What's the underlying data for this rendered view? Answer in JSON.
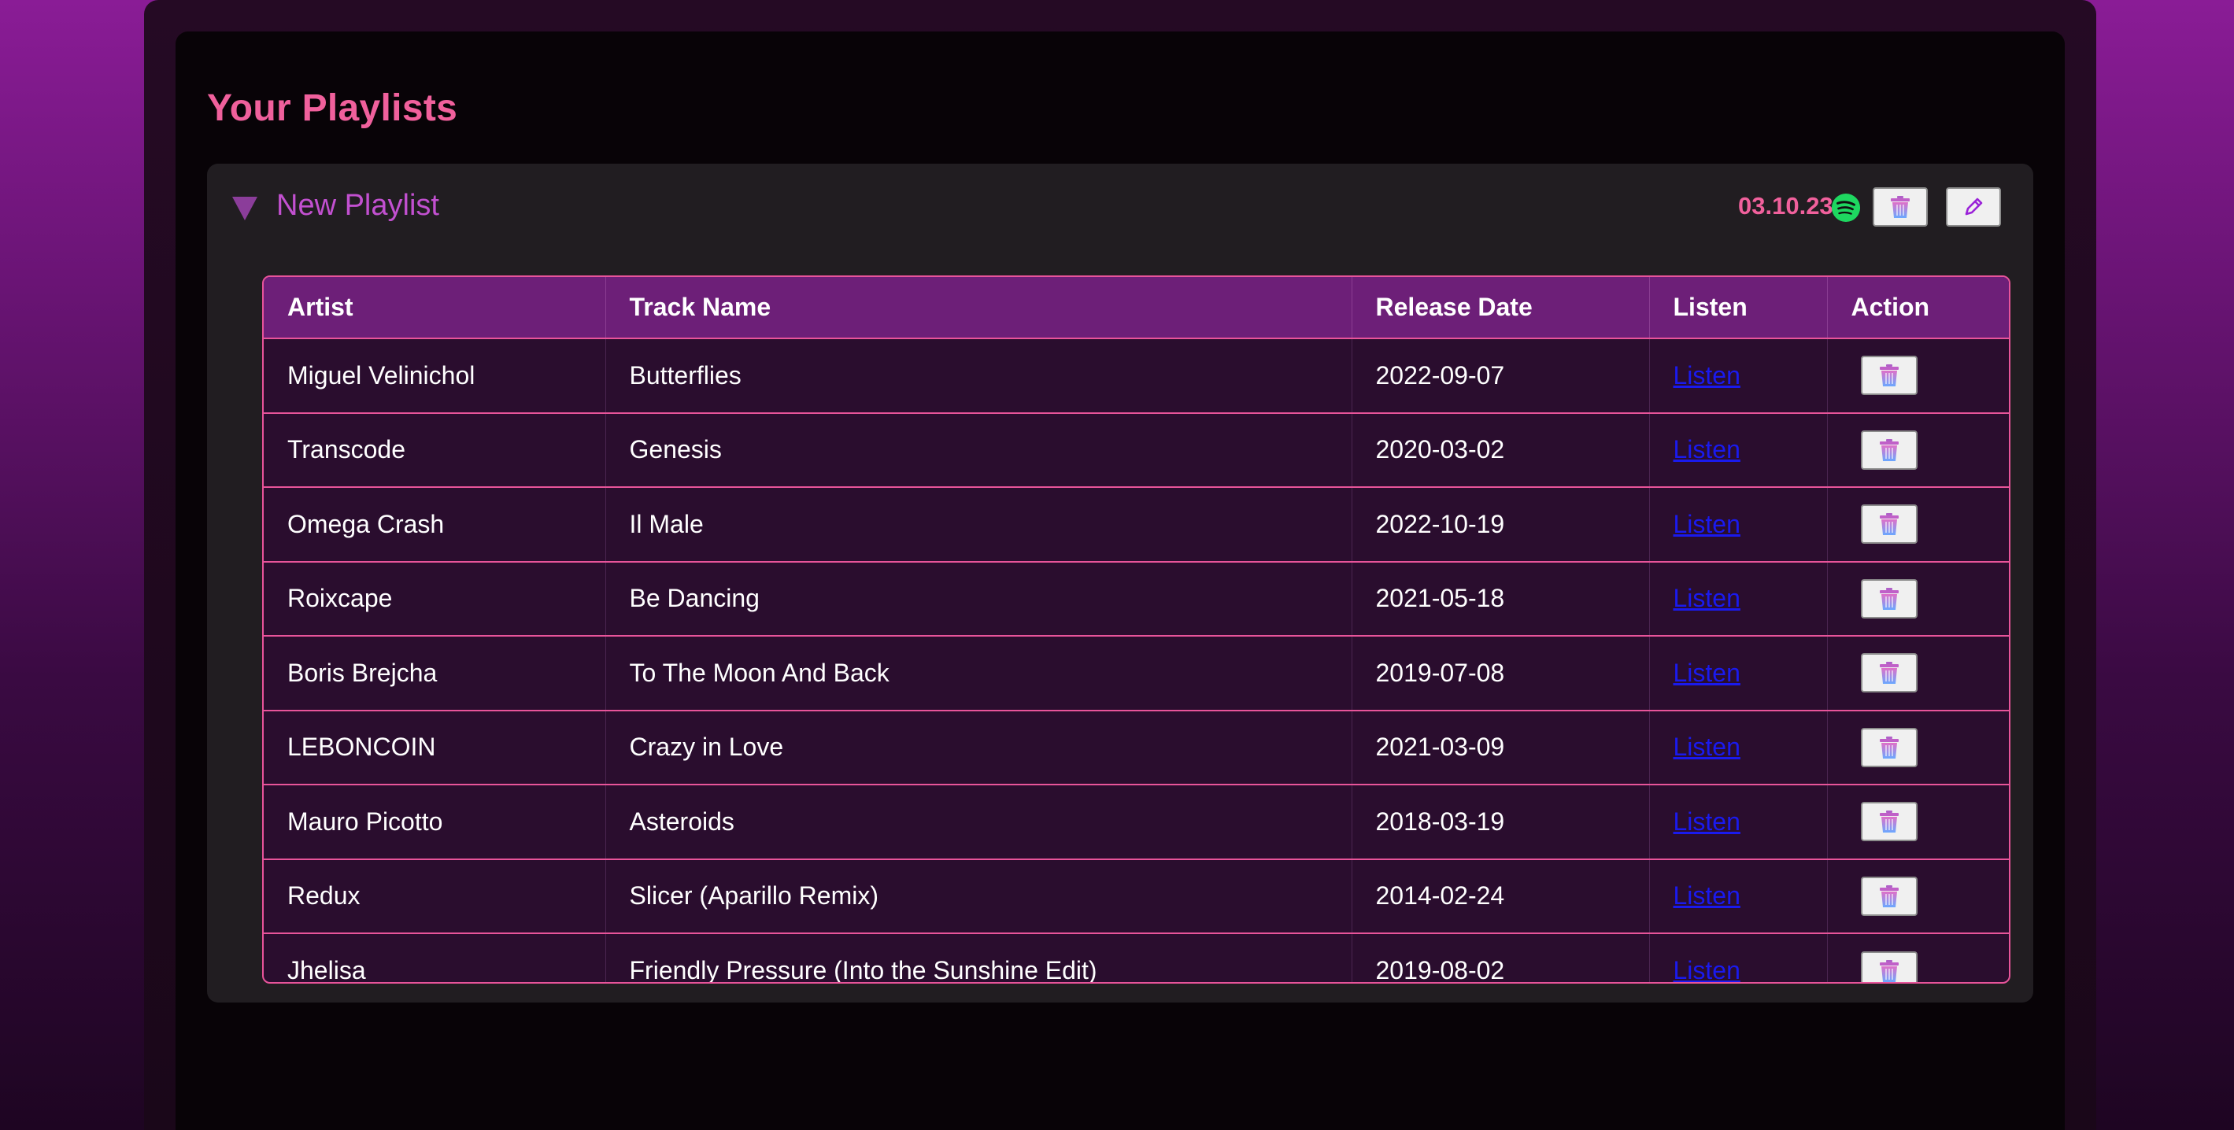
{
  "page": {
    "title": "Your Playlists"
  },
  "playlist": {
    "name": "New Playlist",
    "date": "03.10.23",
    "icons": {
      "service": "spotify-icon",
      "delete": "trash-icon",
      "edit": "pencil-icon",
      "toggle": "triangle-down-icon"
    }
  },
  "table": {
    "columns": [
      "Artist",
      "Track Name",
      "Release Date",
      "Listen",
      "Action"
    ],
    "rows": [
      {
        "artist": "Miguel Velinichol",
        "track": "Butterflies",
        "release": "2022-09-07",
        "listen": "Listen"
      },
      {
        "artist": "Transcode",
        "track": "Genesis",
        "release": "2020-03-02",
        "listen": "Listen"
      },
      {
        "artist": "Omega Crash",
        "track": "Il Male",
        "release": "2022-10-19",
        "listen": "Listen"
      },
      {
        "artist": "Roixcape",
        "track": "Be Dancing",
        "release": "2021-05-18",
        "listen": "Listen"
      },
      {
        "artist": "Boris Brejcha",
        "track": "To The Moon And Back",
        "release": "2019-07-08",
        "listen": "Listen"
      },
      {
        "artist": "LEBONCOIN",
        "track": "Crazy in Love",
        "release": "2021-03-09",
        "listen": "Listen"
      },
      {
        "artist": "Mauro Picotto",
        "track": "Asteroids",
        "release": "2018-03-19",
        "listen": "Listen"
      },
      {
        "artist": "Redux",
        "track": "Slicer (Aparillo Remix)",
        "release": "2014-02-24",
        "listen": "Listen"
      },
      {
        "artist": "Jhelisa",
        "track": "Friendly Pressure (Into the Sunshine Edit)",
        "release": "2019-08-02",
        "listen": "Listen"
      }
    ]
  },
  "colors": {
    "accent_pink": "#f0609c",
    "header_purple": "#6d1f78",
    "row_bg": "#2a0d2e",
    "spotify_green": "#1ed760"
  }
}
